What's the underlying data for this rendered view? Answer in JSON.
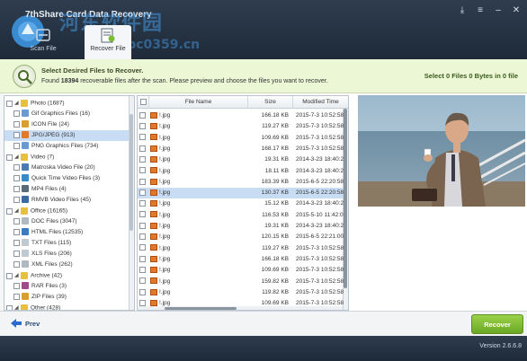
{
  "window": {
    "title": "7thShare Card Data Recovery",
    "controls": [
      "download-icon",
      "menu-icon",
      "minimize-icon",
      "close-icon"
    ]
  },
  "watermark": {
    "text": "河东软件园",
    "url": "www.pc0359.cn"
  },
  "nav_tabs": [
    {
      "label": "Scan File",
      "icon": "scan-icon",
      "active": false
    },
    {
      "label": "Recover File",
      "icon": "recover-file-icon",
      "active": true
    }
  ],
  "info": {
    "title": "Select Desired Files to Recover.",
    "desc_prefix": "Found ",
    "count": "18394",
    "desc_suffix": " recoverable files after the scan. Please preview and choose the files you want to recover.",
    "selected": "Select 0 Files 0 Bytes in 0 file"
  },
  "tree": [
    {
      "label": "Photo (1687)",
      "level": 0,
      "icon": "folder-icon",
      "color": "#e8c040"
    },
    {
      "label": "Gif Graphics Files (16)",
      "level": 1,
      "icon": "gif-icon",
      "color": "#6a9ad0"
    },
    {
      "label": "ICON File (24)",
      "level": 1,
      "icon": "ico-icon",
      "color": "#d8a030"
    },
    {
      "label": "JPG/JPEG (913)",
      "level": 1,
      "icon": "jpg-icon",
      "color": "#e07a2a",
      "selected": true
    },
    {
      "label": "PNG Graphics Files (734)",
      "level": 1,
      "icon": "png-icon",
      "color": "#6a9ad0"
    },
    {
      "label": "Video (7)",
      "level": 0,
      "icon": "folder-icon",
      "color": "#e8c040"
    },
    {
      "label": "Matroska Video File (20)",
      "level": 1,
      "icon": "video-icon",
      "color": "#4a7ab0"
    },
    {
      "label": "Quick Time Video Files (3)",
      "level": 1,
      "icon": "quicktime-icon",
      "color": "#3a8ac8"
    },
    {
      "label": "MP4 Files (4)",
      "level": 1,
      "icon": "mp4-icon",
      "color": "#5a6a7a"
    },
    {
      "label": "RMVB Video Files (45)",
      "level": 1,
      "icon": "rmvb-icon",
      "color": "#3a6aa0"
    },
    {
      "label": "Office (16165)",
      "level": 0,
      "icon": "folder-icon",
      "color": "#e8c040"
    },
    {
      "label": "DOC Files (3047)",
      "level": 1,
      "icon": "doc-icon",
      "color": "#b0b8c0"
    },
    {
      "label": "HTML Files (12535)",
      "level": 1,
      "icon": "html-icon",
      "color": "#3a7ac0"
    },
    {
      "label": "TXT Files (115)",
      "level": 1,
      "icon": "txt-icon",
      "color": "#c0c8d0"
    },
    {
      "label": "XLS Files (206)",
      "level": 1,
      "icon": "xls-icon",
      "color": "#c0c8d0"
    },
    {
      "label": "XML Files (262)",
      "level": 1,
      "icon": "xml-icon",
      "color": "#b0b8c0"
    },
    {
      "label": "Archive (42)",
      "level": 0,
      "icon": "folder-icon",
      "color": "#e8c040"
    },
    {
      "label": "RAR Files (3)",
      "level": 1,
      "icon": "rar-icon",
      "color": "#a04a8a"
    },
    {
      "label": "ZIP Files (39)",
      "level": 1,
      "icon": "zip-icon",
      "color": "#d8a030"
    },
    {
      "label": "Other (428)",
      "level": 0,
      "icon": "folder-icon",
      "color": "#e8c040"
    }
  ],
  "columns": [
    "File Name",
    "Size",
    "Modified Time"
  ],
  "files": [
    {
      "name": "!.jpg",
      "size": "166.18 KB",
      "time": "2015-7-3 10:52:58",
      "selected": false
    },
    {
      "name": "!.jpg",
      "size": "119.27 KB",
      "time": "2015-7-3 10:52:58",
      "selected": false
    },
    {
      "name": "!.jpg",
      "size": "109.69 KB",
      "time": "2015-7-3 10:52:58",
      "selected": false
    },
    {
      "name": "!.jpg",
      "size": "168.17 KB",
      "time": "2015-7-3 10:52:58",
      "selected": false
    },
    {
      "name": "!.jpg",
      "size": "19.31 KB",
      "time": "2014-3-23 18:40:2",
      "selected": false
    },
    {
      "name": "!.jpg",
      "size": "18.11 KB",
      "time": "2014-3-23 18:40:2",
      "selected": false
    },
    {
      "name": "!.jpg",
      "size": "183.39 KB",
      "time": "2015-6-5 22:20:58",
      "selected": false
    },
    {
      "name": "!.jpg",
      "size": "130.37 KB",
      "time": "2015-6-5 22:20:58",
      "selected": true
    },
    {
      "name": "!.jpg",
      "size": "15.12 KB",
      "time": "2014-3-23 18:40:2",
      "selected": false
    },
    {
      "name": "!.jpg",
      "size": "116.53 KB",
      "time": "2015-5-10 11:42:0",
      "selected": false
    },
    {
      "name": "!.jpg",
      "size": "19.31 KB",
      "time": "2014-3-23 18:40:2",
      "selected": false
    },
    {
      "name": "!.jpg",
      "size": "120.15 KB",
      "time": "2015-6-5 22:21:00",
      "selected": false
    },
    {
      "name": "!.jpg",
      "size": "119.27 KB",
      "time": "2015-7-3 10:52:58",
      "selected": false
    },
    {
      "name": "!.jpg",
      "size": "166.18 KB",
      "time": "2015-7-3 10:52:58",
      "selected": false
    },
    {
      "name": "!.jpg",
      "size": "109.69 KB",
      "time": "2015-7-3 10:52:58",
      "selected": false
    },
    {
      "name": "!.jpg",
      "size": "159.82 KB",
      "time": "2015-7-3 10:52:58",
      "selected": false
    },
    {
      "name": "!.jpg",
      "size": "119.82 KB",
      "time": "2015-7-3 10:52:58",
      "selected": false
    },
    {
      "name": "!.jpg",
      "size": "109.69 KB",
      "time": "2015-7-3 10:52:58",
      "selected": false
    }
  ],
  "preview": {
    "icon": "photo-preview-icon"
  },
  "bottom": {
    "prev_label": "Prev",
    "recover_label": "Recover"
  },
  "status": {
    "version": "Version 2.6.6.8"
  },
  "colors": {
    "header_bg": "#2f3d4f",
    "info_bg": "#ecf7d6",
    "selection": "#c8dcf4",
    "recover_green": "#7cbb34"
  }
}
